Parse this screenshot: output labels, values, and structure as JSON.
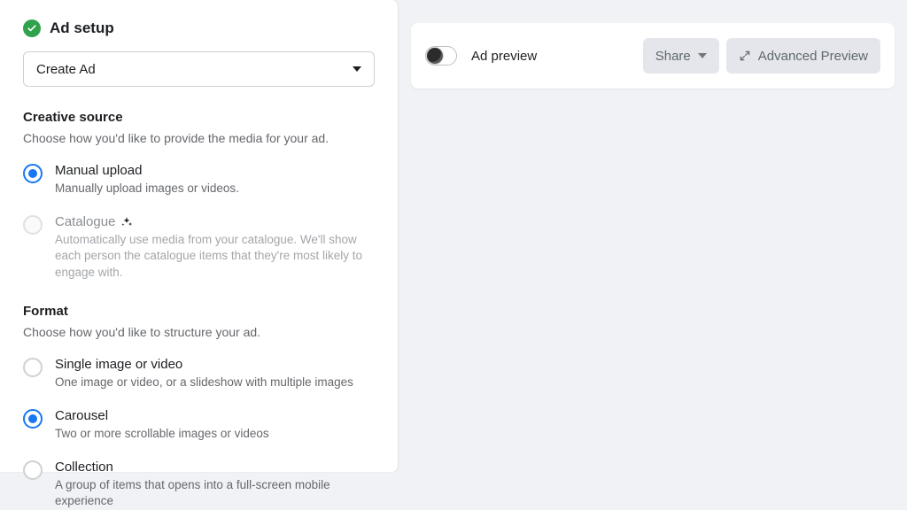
{
  "header": {
    "title": "Ad setup"
  },
  "dropdown": {
    "value": "Create Ad"
  },
  "creative_source": {
    "heading": "Creative source",
    "description": "Choose how you'd like to provide the media for your ad.",
    "options": [
      {
        "label": "Manual upload",
        "description": "Manually upload images or videos.",
        "selected": true,
        "disabled": false
      },
      {
        "label": "Catalogue",
        "description": "Automatically use media from your catalogue. We'll show each person the catalogue items that they're most likely to engage with.",
        "selected": false,
        "disabled": true
      }
    ]
  },
  "format": {
    "heading": "Format",
    "description": "Choose how you'd like to structure your ad.",
    "options": [
      {
        "label": "Single image or video",
        "description": "One image or video, or a slideshow with multiple images",
        "selected": false
      },
      {
        "label": "Carousel",
        "description": "Two or more scrollable images or videos",
        "selected": true
      },
      {
        "label": "Collection",
        "description": "A group of items that opens into a full-screen mobile experience",
        "selected": false
      }
    ]
  },
  "preview": {
    "label": "Ad preview",
    "toggle_on": false,
    "share_label": "Share",
    "advanced_label": "Advanced Preview"
  }
}
